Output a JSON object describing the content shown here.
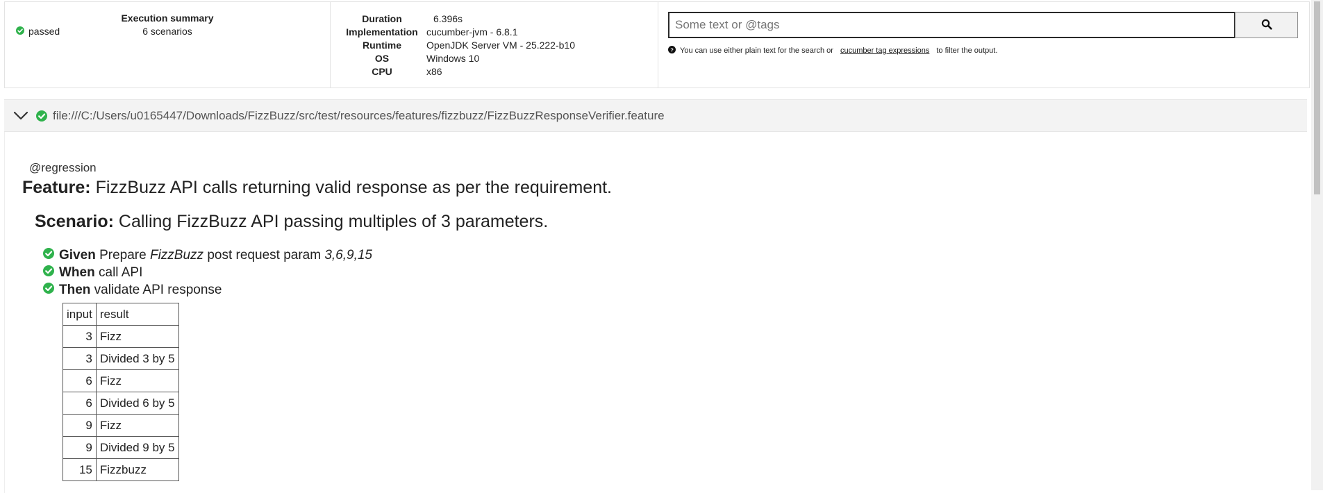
{
  "summary": {
    "title": "Execution summary",
    "status": "passed",
    "scenarios": "6 scenarios"
  },
  "environment": [
    {
      "key": "Duration",
      "value": "6.396s"
    },
    {
      "key": "Implementation",
      "value": "cucumber-jvm - 6.8.1"
    },
    {
      "key": "Runtime",
      "value": "OpenJDK Server VM - 25.222-b10"
    },
    {
      "key": "OS",
      "value": "Windows 10"
    },
    {
      "key": "CPU",
      "value": "x86"
    }
  ],
  "search": {
    "placeholder": "Some text or @tags",
    "help_prefix": "You can use either plain text for the search or",
    "help_link": "cucumber tag expressions",
    "help_suffix": "to filter the output."
  },
  "feature": {
    "file_path": "file:///C:/Users/u0165447/Downloads/FizzBuzz/src/test/resources/features/fizzbuzz/FizzBuzzResponseVerifier.feature",
    "tag": "@regression",
    "keyword": "Feature:",
    "name": "FizzBuzz API calls returning valid response as per the requirement.",
    "scenario": {
      "keyword": "Scenario:",
      "name": "Calling FizzBuzz API passing multiples of 3 parameters.",
      "steps": [
        {
          "keyword": "Given",
          "text_before": "Prepare",
          "param1": "FizzBuzz",
          "text_middle": "post request param",
          "param2": "3,6,9,15"
        },
        {
          "keyword": "When",
          "text": "call API"
        },
        {
          "keyword": "Then",
          "text": "validate API response"
        }
      ],
      "table": {
        "headers": [
          "input",
          "result"
        ],
        "rows": [
          [
            "3",
            "Fizz"
          ],
          [
            "3",
            "Divided 3 by 5"
          ],
          [
            "6",
            "Fizz"
          ],
          [
            "6",
            "Divided 6 by 5"
          ],
          [
            "9",
            "Fizz"
          ],
          [
            "9",
            "Divided 9 by 5"
          ],
          [
            "15",
            "Fizzbuzz"
          ]
        ]
      }
    }
  },
  "colors": {
    "pass_green": "#2fb24c",
    "border": "#e3e3e3",
    "feature_bar_bg": "#f3f3f3"
  },
  "icons": {
    "status": "check-circle-icon",
    "search": "search-icon",
    "help": "question-circle-icon",
    "collapse": "chevron-down-icon"
  }
}
